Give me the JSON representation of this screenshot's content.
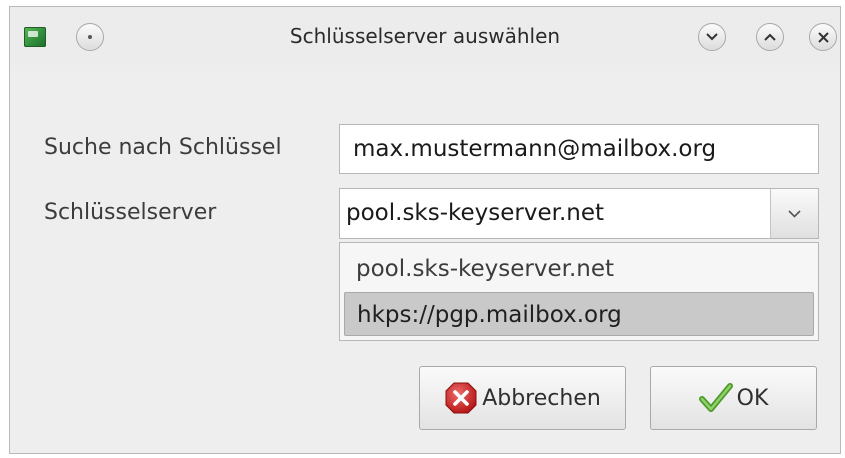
{
  "window": {
    "title": "Schlüsselserver auswählen",
    "controls": {
      "menu": "menu-icon",
      "minimize": "chevron-down-icon",
      "maximize": "chevron-up-icon",
      "close": "close-icon"
    }
  },
  "form": {
    "search_label": "Suche nach Schlüssel",
    "search_value": "max.mustermann@mailbox.org",
    "server_label": "Schlüsselserver",
    "server_selected": "pool.sks-keyserver.net",
    "server_options": [
      "pool.sks-keyserver.net",
      "hkps://pgp.mailbox.org"
    ],
    "highlighted_option": "hkps://pgp.mailbox.org"
  },
  "buttons": {
    "cancel_label": "Abbrechen",
    "ok_label": "OK"
  },
  "colors": {
    "cancel_icon": "#d22b2b",
    "ok_icon": "#6db33f",
    "highlight": "#c9c9c9"
  }
}
